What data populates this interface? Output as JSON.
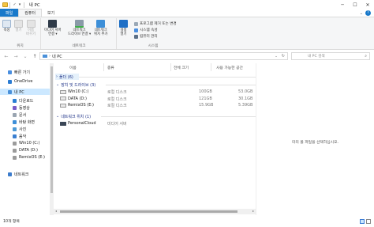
{
  "window": {
    "title": "내 PC",
    "quick_access": [
      "✓",
      "▾"
    ],
    "controls": {
      "minimize": "─",
      "maximize": "☐",
      "close": "✕"
    }
  },
  "ribbon": {
    "tabs": [
      "파일",
      "컴퓨터",
      "보기"
    ],
    "help": "?",
    "groups": {
      "location": {
        "label": "위치",
        "buttons": [
          "속성",
          "열기",
          "이름\n바꾸기"
        ]
      },
      "network": {
        "label": "네트워크",
        "buttons": [
          "미디어 서버\n연결 ▾",
          "네트워크\n드라이브 연결 ▾",
          "네트워크\n위치 추가"
        ]
      },
      "system": {
        "label": "시스템",
        "open_settings": "설정\n열기",
        "items": [
          "프로그램 제거 또는 변경",
          "시스템 속성",
          "컴퓨터 관리"
        ]
      }
    }
  },
  "address": {
    "back": "←",
    "forward": "→",
    "recent": "⌄",
    "up": "↑",
    "crumb_sep": "›",
    "crumb": "내 PC",
    "dropdown": "⌄",
    "refresh": "↻",
    "search_placeholder": "내 PC 검색",
    "search_icon": "⌕"
  },
  "nav": {
    "items": [
      {
        "label": "빠른 가기",
        "icon": "star-icon",
        "color": "#4a8fe0",
        "indent": 1
      },
      {
        "label": "OneDrive",
        "icon": "cloud-icon",
        "color": "#2b7cd3",
        "indent": 1
      },
      {
        "label": "내 PC",
        "icon": "computer-icon",
        "color": "#4a90d9",
        "indent": 1,
        "selected": true
      },
      {
        "label": "다운로드",
        "icon": "download-icon",
        "color": "#2a7fd4",
        "indent": 2
      },
      {
        "label": "동영상",
        "icon": "video-icon",
        "color": "#7a5cc8",
        "indent": 2
      },
      {
        "label": "문서",
        "icon": "document-icon",
        "color": "#9aa5b1",
        "indent": 2
      },
      {
        "label": "바탕 화면",
        "icon": "desktop-icon",
        "color": "#3d8fd8",
        "indent": 2
      },
      {
        "label": "사진",
        "icon": "picture-icon",
        "color": "#4d9ad6",
        "indent": 2
      },
      {
        "label": "음악",
        "icon": "music-icon",
        "color": "#3a7fd0",
        "indent": 2
      },
      {
        "label": "Win10 (C:)",
        "icon": "drive-icon",
        "color": "#9b9b9b",
        "indent": 2
      },
      {
        "label": "DATA (D:)",
        "icon": "drive-icon",
        "color": "#9b9b9b",
        "indent": 2
      },
      {
        "label": "RemixOS (E:)",
        "icon": "drive-icon",
        "color": "#9b9b9b",
        "indent": 2
      },
      {
        "label": "네트워크",
        "icon": "network-icon",
        "color": "#3c7ccc",
        "indent": 1
      }
    ]
  },
  "columns": [
    "이름",
    "종류",
    "전체 크기",
    "사용 가능한 공간"
  ],
  "groups": [
    {
      "label": "폴더 (6)"
    },
    {
      "label": "장치 및 드라이브 (3)"
    },
    {
      "label": "네트워크 위치 (1)"
    }
  ],
  "drives": [
    {
      "name": "Win10 (C:)",
      "type": "로컬 디스크",
      "total": "100GB",
      "free": "53.0GB"
    },
    {
      "name": "DATA (D:)",
      "type": "로컬 디스크",
      "total": "121GB",
      "free": "30.1GB"
    },
    {
      "name": "RemixOS (E:)",
      "type": "로컬 디스크",
      "total": "15.9GB",
      "free": "5.39GB"
    }
  ],
  "network_locations": [
    {
      "name": "PersonalCloud",
      "type": "미디어 서버"
    }
  ],
  "preview": {
    "message": "미리 볼 파일을 선택하십시오."
  },
  "status": {
    "count": "10개 항목"
  },
  "colors": {
    "file_tab": "#1979ca",
    "selection": "#cce8ff",
    "group_header": "#1e3287"
  }
}
